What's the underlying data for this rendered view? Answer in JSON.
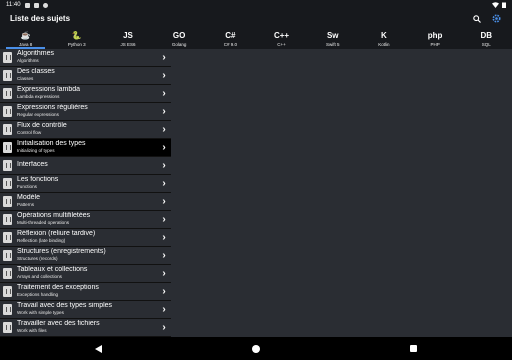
{
  "status": {
    "time": "11:40"
  },
  "app": {
    "title": "Liste des sujets"
  },
  "tabs": [
    {
      "label": "Java 8",
      "icon": "java-icon",
      "glyph": "☕",
      "active": true
    },
    {
      "label": "Python 3",
      "icon": "python-icon",
      "glyph": "🐍"
    },
    {
      "label": "JS ES6",
      "icon": "js-icon",
      "glyph": "JS"
    },
    {
      "label": "Golang",
      "icon": "golang-icon",
      "glyph": "GO"
    },
    {
      "label": "C# 9.0",
      "icon": "csharp-icon",
      "glyph": "C#"
    },
    {
      "label": "C++",
      "icon": "cpp-icon",
      "glyph": "C++"
    },
    {
      "label": "Swift 5",
      "icon": "swift-icon",
      "glyph": "Sw"
    },
    {
      "label": "Kotlin",
      "icon": "kotlin-icon",
      "glyph": "K"
    },
    {
      "label": "PHP",
      "icon": "php-icon",
      "glyph": "php"
    },
    {
      "label": "SQL",
      "icon": "sql-icon",
      "glyph": "DB"
    }
  ],
  "topics": [
    {
      "fr": "Algorithmes",
      "en": "Algorithms"
    },
    {
      "fr": "Des classes",
      "en": "Classes"
    },
    {
      "fr": "Expressions lambda",
      "en": "Lambda expressions"
    },
    {
      "fr": "Expressions régulières",
      "en": "Regular expressions"
    },
    {
      "fr": "Flux de contrôle",
      "en": "Control flow"
    },
    {
      "fr": "Initialisation des types",
      "en": "Initializing of types",
      "selected": true
    },
    {
      "fr": "Interfaces",
      "en": ""
    },
    {
      "fr": "Les fonctions",
      "en": "Functions"
    },
    {
      "fr": "Modèle",
      "en": "Patterns"
    },
    {
      "fr": "Opérations multifiletées",
      "en": "Multi-threaded operations"
    },
    {
      "fr": "Réflexion (reliure tardive)",
      "en": "Reflection (late binding)"
    },
    {
      "fr": "Structures (enregistrements)",
      "en": "Structures (records)"
    },
    {
      "fr": "Tableaux et collections",
      "en": "Arrays and collections"
    },
    {
      "fr": "Traitement des exceptions",
      "en": "Exceptions handling"
    },
    {
      "fr": "Travail avec des types simples",
      "en": "Work with simple types"
    },
    {
      "fr": "Travailler avec des fichiers",
      "en": "Work with files"
    }
  ],
  "colors": {
    "accent": "#4a8fe8",
    "background": "#2a2d33",
    "bar": "#17191d"
  }
}
